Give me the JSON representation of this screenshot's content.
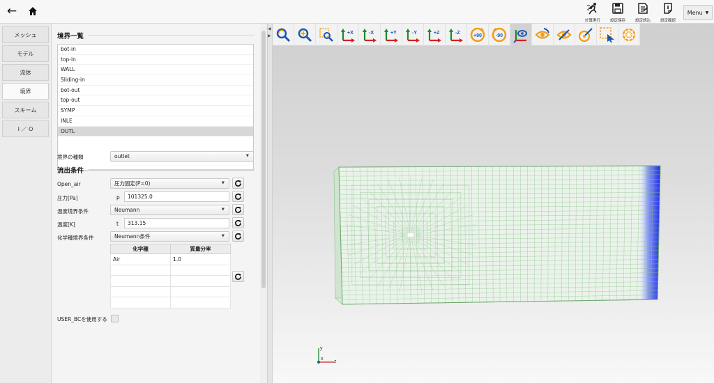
{
  "nav": {
    "back_icon": "arrow-left-icon",
    "home_icon": "home-icon"
  },
  "top_actions": [
    {
      "label": "計算実行",
      "icon": "run-icon"
    },
    {
      "label": "設定保存",
      "icon": "save-icon"
    },
    {
      "label": "設定読込",
      "icon": "load-icon"
    },
    {
      "label": "設定確認",
      "icon": "check-icon"
    }
  ],
  "menu_label": "Menu",
  "sidebar": {
    "tabs": [
      {
        "label": "メッシュ"
      },
      {
        "label": "モデル"
      },
      {
        "label": "流体"
      },
      {
        "label": "境界",
        "active": true
      },
      {
        "label": "スキーム"
      },
      {
        "label": "I ／ O"
      }
    ]
  },
  "boundary": {
    "section_title": "境界一覧",
    "list": [
      "bot-in",
      "top-in",
      "WALL",
      "Sliding-in",
      "bot-out",
      "top-out",
      "SYMP",
      "INLE",
      "OUTL"
    ],
    "selected": "OUTL",
    "type_label": "境界の種類",
    "type_value": "outlet"
  },
  "outflow": {
    "section_title": "流出条件",
    "open_air_label": "Open_air",
    "open_air_value": "圧力固定(P=0)",
    "pressure_label": "圧力[Pa]",
    "pressure_var": "p",
    "pressure_value": "101325.0",
    "temp_bc_label": "温度境界条件",
    "temp_bc_value": "Neumann",
    "temp_label": "温度[K]",
    "temp_var": "t",
    "temp_value": "313.15",
    "chem_bc_label": "化学種境界条件",
    "chem_bc_value": "Neumann条件",
    "table_headers": [
      "化学種",
      "質量分率"
    ],
    "table_rows": [
      [
        "Air",
        "1.0"
      ],
      [
        "",
        ""
      ],
      [
        "",
        ""
      ],
      [
        "",
        ""
      ],
      [
        "",
        ""
      ]
    ],
    "user_bc_label": "USER_BCを使用する",
    "user_bc_checked": false
  },
  "viewer": {
    "toolbar": [
      {
        "icon": "zoom-fit-icon",
        "label": ""
      },
      {
        "icon": "zoom-in-icon",
        "label": ""
      },
      {
        "icon": "zoom-box-icon",
        "label": ""
      },
      {
        "icon": "view-plus-x-icon",
        "label": "+X"
      },
      {
        "icon": "view-minus-x-icon",
        "label": "-X"
      },
      {
        "icon": "view-plus-y-icon",
        "label": "+Y"
      },
      {
        "icon": "view-minus-y-icon",
        "label": "-Y"
      },
      {
        "icon": "view-plus-z-icon",
        "label": "+Z"
      },
      {
        "icon": "view-minus-z-icon",
        "label": "-Z"
      },
      {
        "icon": "rotate-plus-90-icon",
        "label": "+90"
      },
      {
        "icon": "rotate-minus-90-icon",
        "label": "-90"
      },
      {
        "icon": "show-axis-icon",
        "label": "",
        "active": true
      },
      {
        "icon": "visibility-icon",
        "label": ""
      },
      {
        "icon": "visibility-toggle-icon",
        "label": ""
      },
      {
        "icon": "pick-icon",
        "label": ""
      },
      {
        "icon": "select-box-icon",
        "label": ""
      },
      {
        "icon": "settings-wheel-icon",
        "label": ""
      }
    ],
    "axis_labels": {
      "x": "z",
      "y": "y",
      "z": "x"
    },
    "colors": {
      "mesh_fill": "#eaf3ea",
      "mesh_line": "#8dbf8d",
      "outlet_face": "#1f2fe8",
      "accent_orange": "#f39c12",
      "accent_blue": "#1a56b5"
    }
  }
}
